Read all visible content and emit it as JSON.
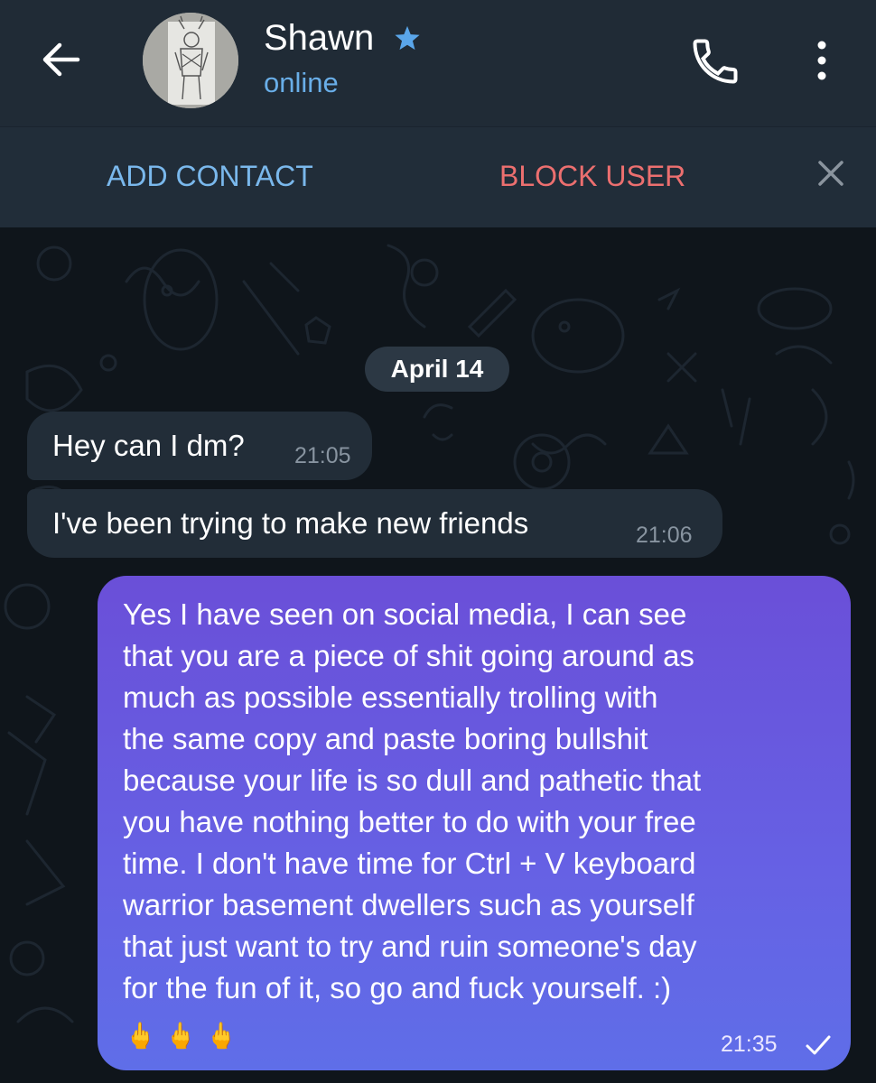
{
  "header": {
    "contact_name": "Shawn",
    "status": "online",
    "colors": {
      "background": "#202b36",
      "status": "#69aee8",
      "star": "#5aa6ea"
    }
  },
  "action_bar": {
    "add_contact": "ADD CONTACT",
    "block_user": "BLOCK USER",
    "colors": {
      "add": "#7ab8ec",
      "block": "#ec6f6f"
    }
  },
  "chat": {
    "date": "April 14",
    "messages": [
      {
        "direction": "incoming",
        "text": "Hey can I dm?",
        "time": "21:05"
      },
      {
        "direction": "incoming",
        "text": "I've been trying to make new friends",
        "time": "21:06"
      },
      {
        "direction": "outgoing",
        "text": "Yes I have seen on social media, I can see\nthat you are a piece of shit going around as\nmuch as possible essentially trolling with\nthe same copy and paste boring bullshit\nbecause your life is so dull and pathetic that\nyou have nothing better to do with your free\ntime. I don't have time for Ctrl + V keyboard\nwarrior basement dwellers such as yourself\nthat just want to try and ruin someone's day\nfor the fun of it, so go and fuck yourself. :)",
        "emoji": "🖕🖕🖕",
        "time": "21:35"
      }
    ]
  },
  "icons": [
    "back-arrow-icon",
    "verified-star-icon",
    "phone-icon",
    "more-vertical-icon",
    "close-icon",
    "check-icon"
  ]
}
